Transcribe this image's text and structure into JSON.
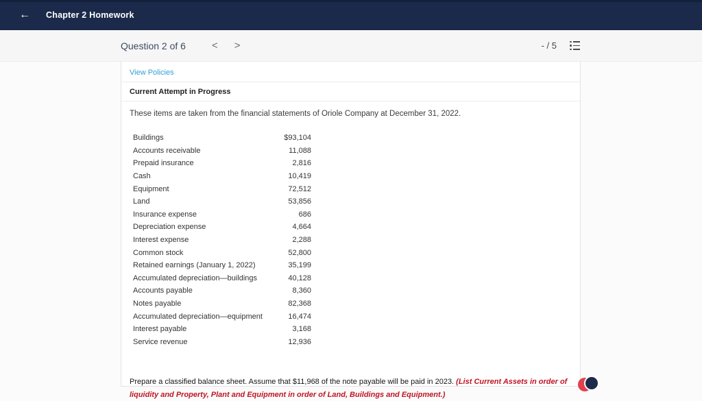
{
  "header": {
    "title": "Chapter 2 Homework"
  },
  "icons": {
    "back": "←"
  },
  "toolbar": {
    "question_label": "Question 2 of 6",
    "prev": "<",
    "next": ">",
    "score": "- / 5"
  },
  "panel": {
    "view_policies": "View Policies",
    "attempt_status": "Current Attempt in Progress",
    "intro": "These items are taken from the financial statements of Oriole Company at December 31, 2022.",
    "items": [
      {
        "label": "Buildings",
        "value": "$93,104"
      },
      {
        "label": "Accounts receivable",
        "value": "11,088"
      },
      {
        "label": "Prepaid insurance",
        "value": "2,816"
      },
      {
        "label": "Cash",
        "value": "10,419"
      },
      {
        "label": "Equipment",
        "value": "72,512"
      },
      {
        "label": "Land",
        "value": "53,856"
      },
      {
        "label": "Insurance expense",
        "value": "686"
      },
      {
        "label": "Depreciation expense",
        "value": "4,664"
      },
      {
        "label": "Interest expense",
        "value": "2,288"
      },
      {
        "label": "Common stock",
        "value": "52,800"
      },
      {
        "label": "Retained earnings (January 1, 2022)",
        "value": "35,199"
      },
      {
        "label": "Accumulated depreciation—buildings",
        "value": "40,128"
      },
      {
        "label": "Accounts payable",
        "value": "8,360"
      },
      {
        "label": "Notes payable",
        "value": "82,368"
      },
      {
        "label": "Accumulated depreciation—equipment",
        "value": "16,474"
      },
      {
        "label": "Interest payable",
        "value": "3,168"
      },
      {
        "label": "Service revenue",
        "value": "12,936"
      }
    ],
    "instruction_normal": "Prepare a classified balance sheet. Assume that $11,968 of the note payable will be paid in 2023. ",
    "instruction_emphasis": "(List Current Assets in order of liquidity and Property, Plant and Equipment in order of Land, Buildings and Equipment.)"
  }
}
